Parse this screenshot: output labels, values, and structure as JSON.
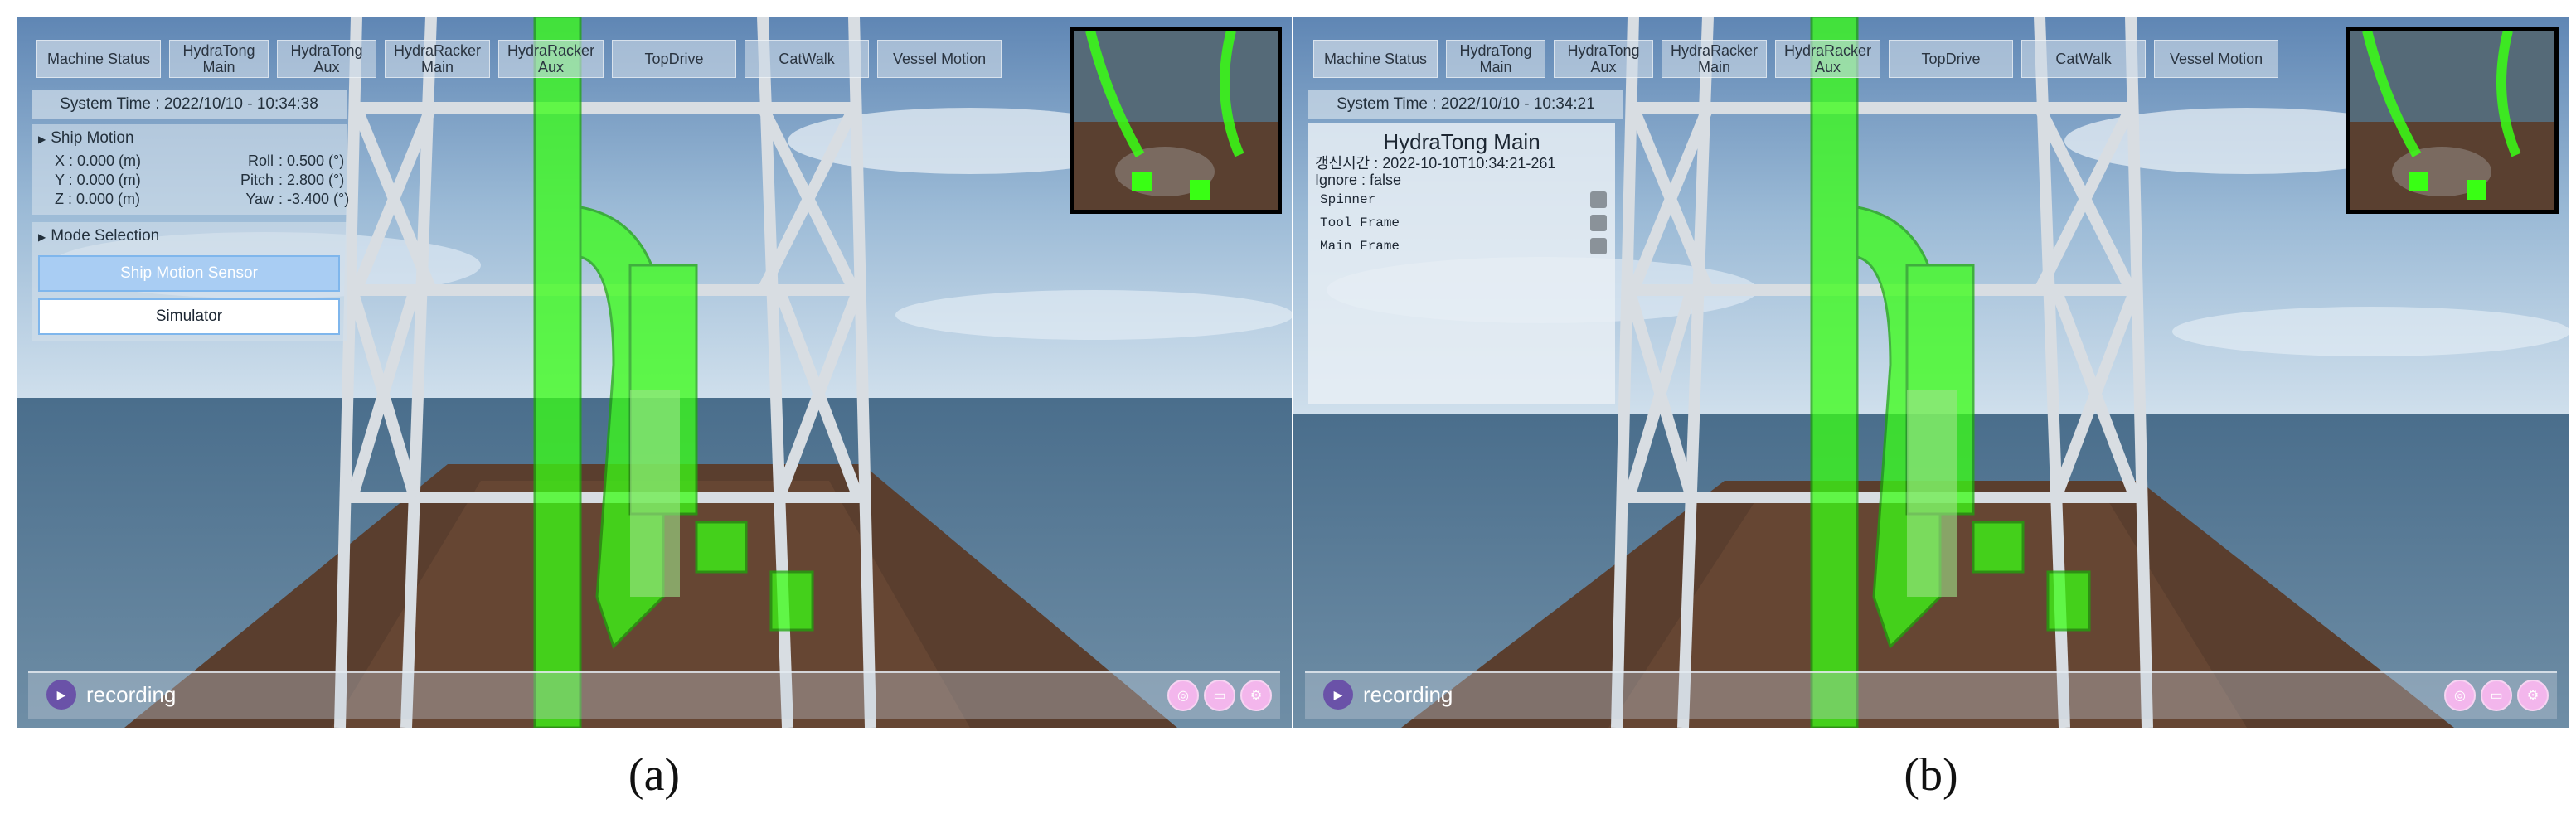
{
  "nav": {
    "machine_status": "Machine Status",
    "items": [
      {
        "l1": "HydraTong",
        "l2": "Main"
      },
      {
        "l1": "HydraTong",
        "l2": "Aux"
      },
      {
        "l1": "HydraRacker",
        "l2": "Main"
      },
      {
        "l1": "HydraRacker",
        "l2": "Aux"
      },
      {
        "l1": "TopDrive",
        "l2": ""
      },
      {
        "l1": "CatWalk",
        "l2": ""
      },
      {
        "l1": "Vessel Motion",
        "l2": ""
      }
    ]
  },
  "panel_a": {
    "caption": "(a)",
    "system_time": "System Time : 2022/10/10 - 10:34:38",
    "ship_motion": {
      "title": "Ship Motion",
      "x": "X : 0.000 (m)",
      "y": "Y : 0.000 (m)",
      "z": "Z : 0.000 (m)",
      "roll_label": "Roll",
      "roll_value": ": 0.500 (°)",
      "pitch_label": "Pitch",
      "pitch_value": ": 2.800 (°)",
      "yaw_label": "Yaw",
      "yaw_value": ": -3.400 (°)"
    },
    "mode_selection": {
      "title": "Mode Selection",
      "options": [
        "Ship Motion Sensor",
        "Simulator"
      ],
      "selected": "Ship Motion Sensor"
    },
    "recording": "recording"
  },
  "panel_b": {
    "caption": "(b)",
    "system_time": "System Time : 2022/10/10 - 10:34:21",
    "info": {
      "title": "HydraTong Main",
      "updated": "갱신시간 : 2022-10-10T10:34:21-261",
      "ignore": "Ignore : false",
      "options": [
        "Spinner",
        "Tool Frame",
        "Main Frame"
      ]
    },
    "recording": "recording"
  },
  "colors": {
    "accent_blue": "#a9cdf3",
    "highlight_green": "#39ff14",
    "record_purple": "#6a52a8",
    "control_pink": "#f3b6ec"
  },
  "icons": [
    "play-icon",
    "capture-icon",
    "folder-icon",
    "settings-icon"
  ]
}
